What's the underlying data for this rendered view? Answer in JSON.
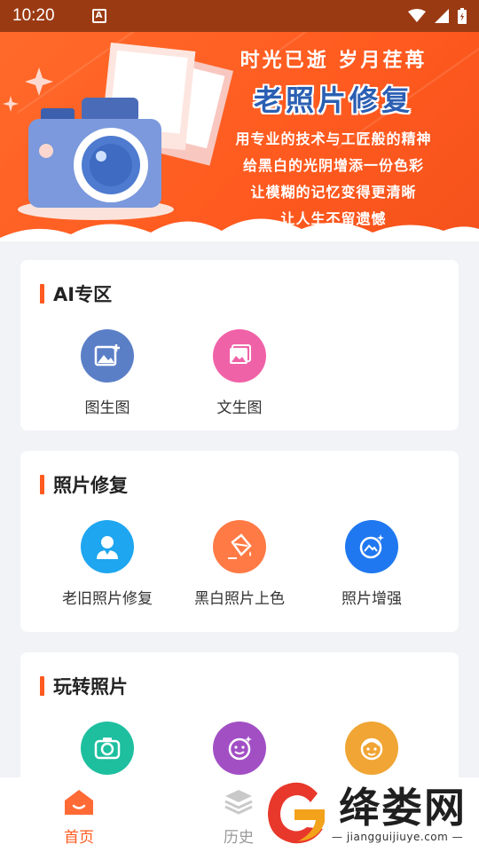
{
  "status_bar": {
    "time": "10:20",
    "notification_badge": "A"
  },
  "banner": {
    "line1": "时光已逝  岁月荏苒",
    "title": "老照片修复",
    "slogans": [
      "用专业的技术与工匠般的精神",
      "给黑白的光阴增添一份色彩",
      "让模糊的记忆变得更清晰",
      "让人生不留遗憾"
    ]
  },
  "sections": [
    {
      "title": "AI专区",
      "tools": [
        {
          "label": "图生图",
          "icon": "image-plus-icon",
          "color": "#5b7fc7"
        },
        {
          "label": "文生图",
          "icon": "gallery-icon",
          "color": "#f062a8"
        }
      ]
    },
    {
      "title": "照片修复",
      "tools": [
        {
          "label": "老旧照片修复",
          "icon": "portrait-icon",
          "color": "#1ea6f0"
        },
        {
          "label": "黑白照片上色",
          "icon": "paint-bucket-icon",
          "color": "#ff7a45"
        },
        {
          "label": "照片增强",
          "icon": "enhance-icon",
          "color": "#1f78f0"
        }
      ]
    },
    {
      "title": "玩转照片",
      "tools": [
        {
          "label": "",
          "icon": "camera-icon",
          "color": "#1dbf9f"
        },
        {
          "label": "",
          "icon": "face-sparkle-icon",
          "color": "#a24fc4"
        },
        {
          "label": "",
          "icon": "kid-face-icon",
          "color": "#f0a534"
        }
      ]
    }
  ],
  "bottom_nav": [
    {
      "label": "首页",
      "icon": "home-icon",
      "active": true
    },
    {
      "label": "历史",
      "icon": "layers-icon",
      "active": false
    }
  ],
  "watermark": {
    "brand": "绛娄网",
    "url": "jiangguijiuye.com"
  },
  "colors": {
    "accent": "#ff5a1f",
    "status_bar": "#9a3a13",
    "title_blue": "#2b5fb3"
  }
}
